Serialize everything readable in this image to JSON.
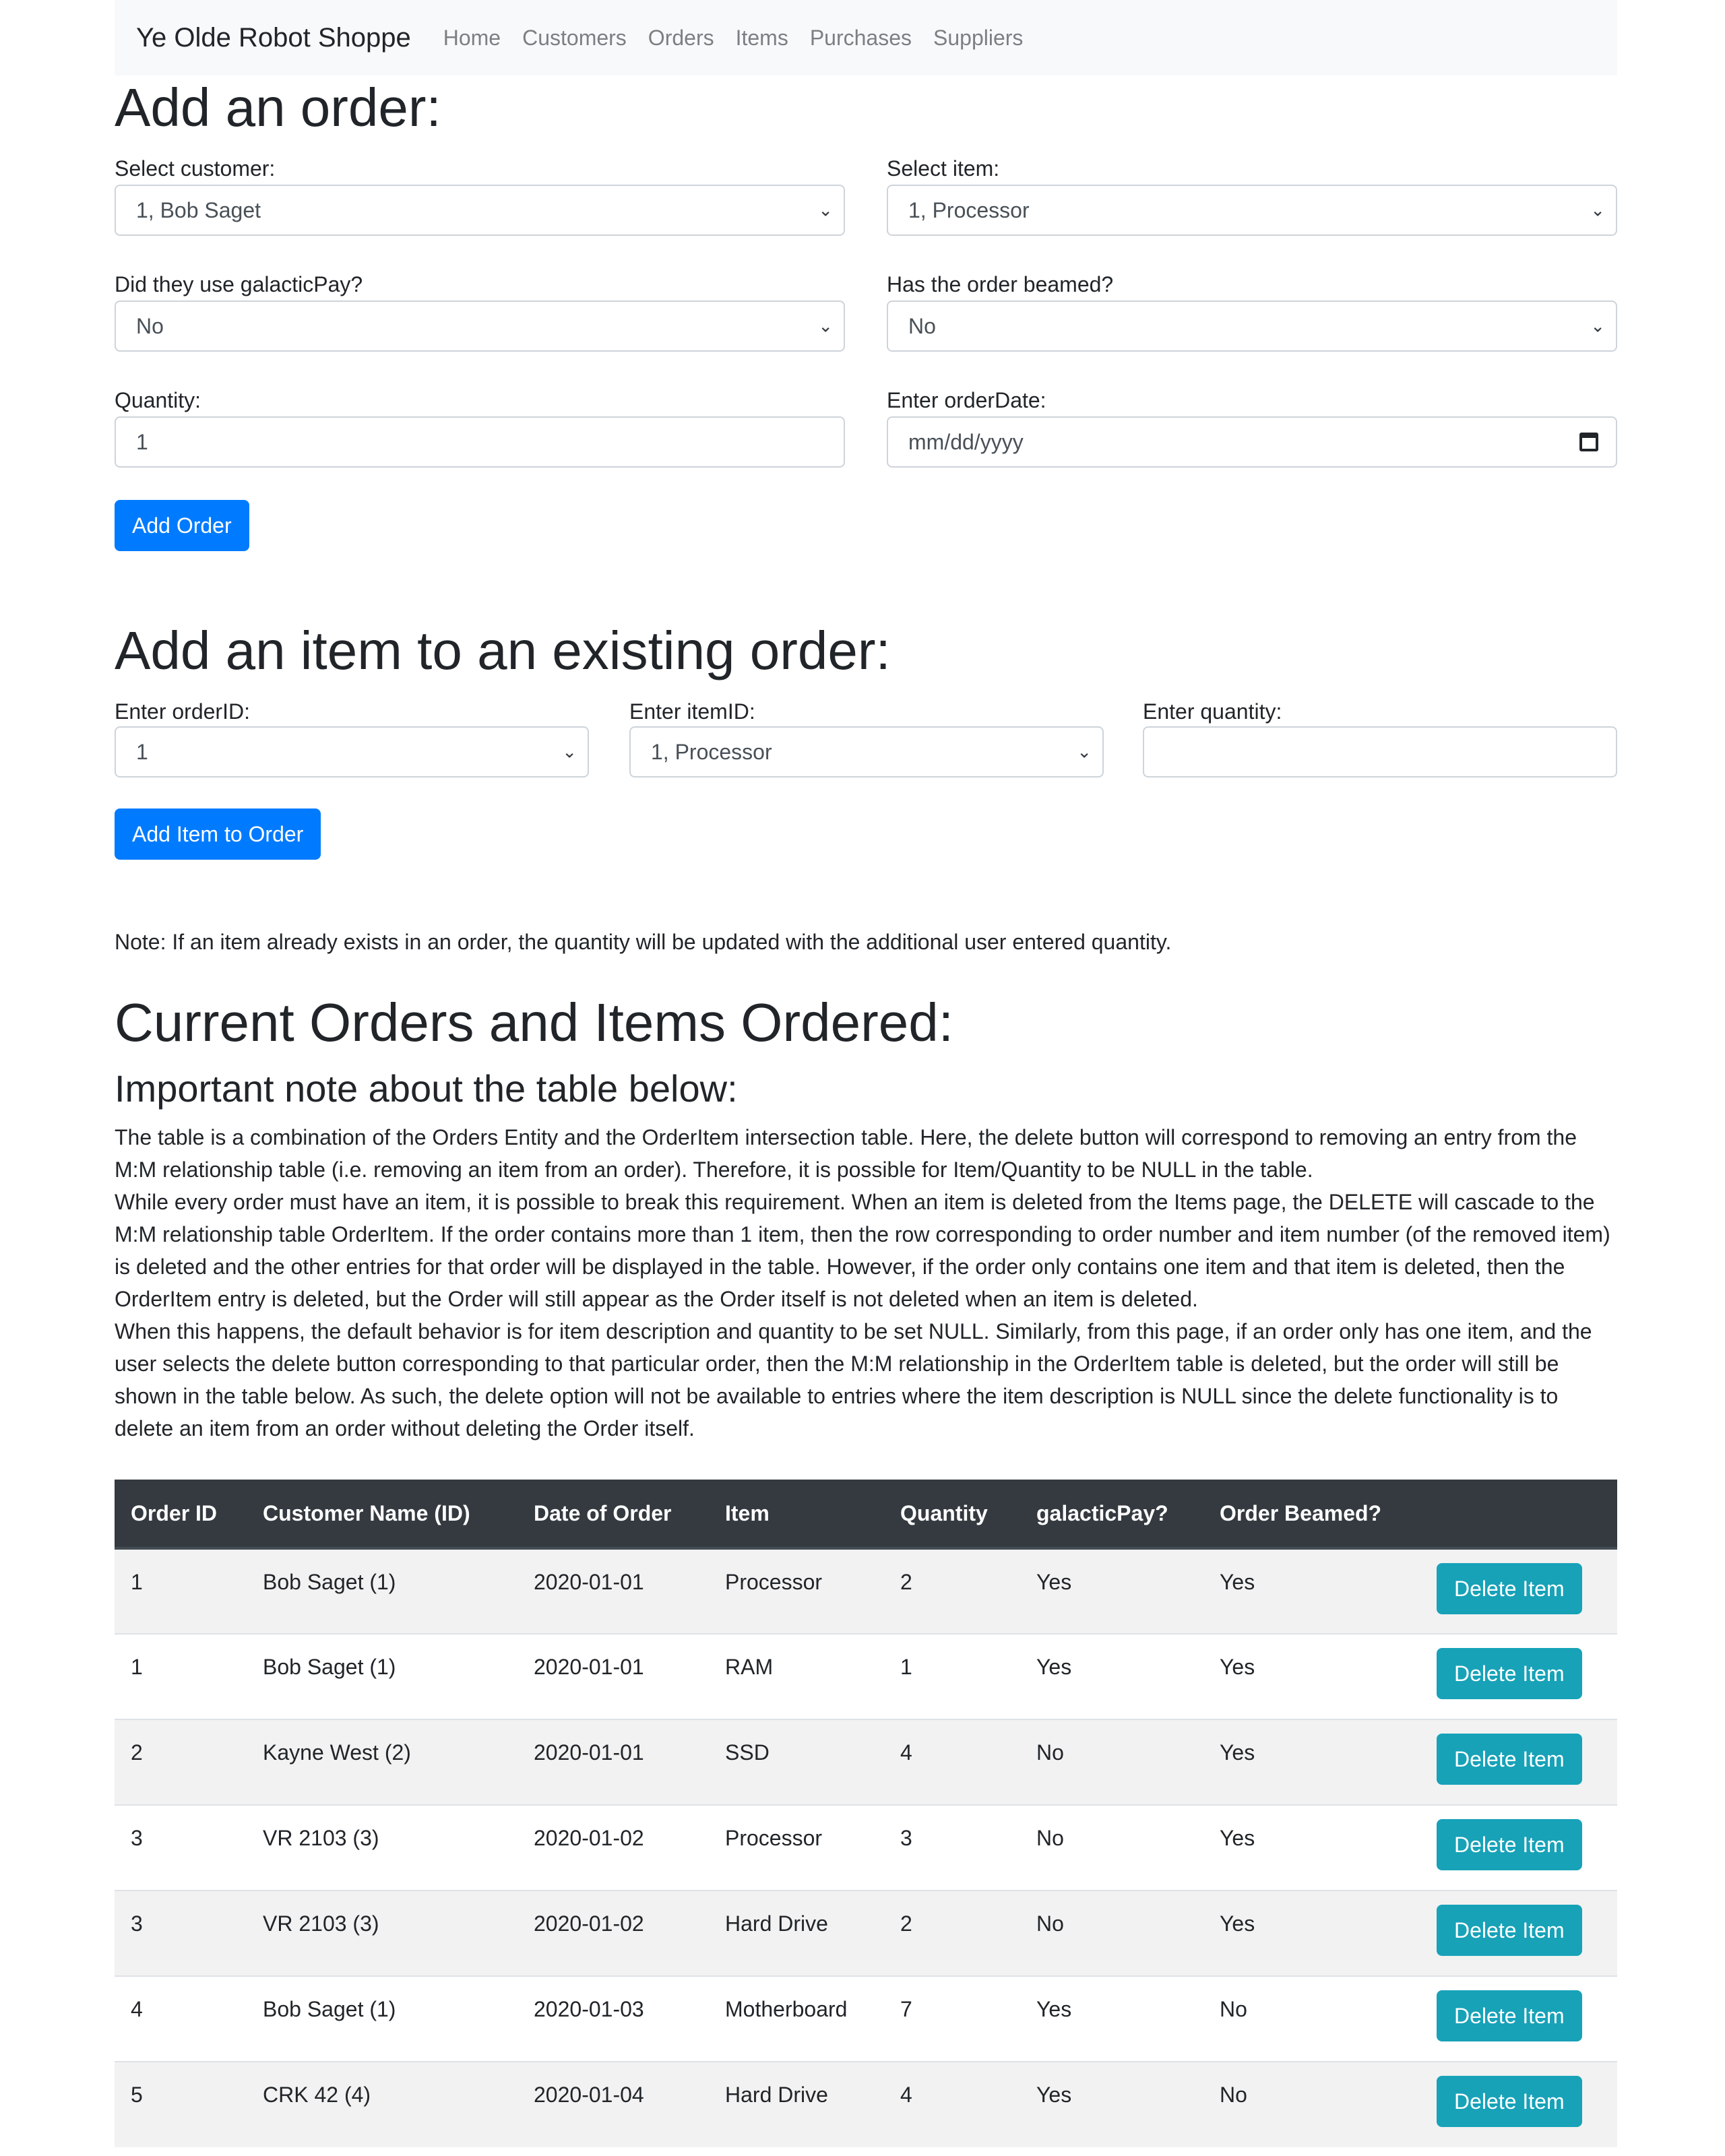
{
  "navbar": {
    "brand": "Ye Olde Robot Shoppe",
    "links": [
      "Home",
      "Customers",
      "Orders",
      "Items",
      "Purchases",
      "Suppliers"
    ]
  },
  "add_order": {
    "heading": "Add an order:",
    "customer_label": "Select customer:",
    "customer_value": "1, Bob Saget",
    "item_label": "Select item:",
    "item_value": "1, Processor",
    "galactic_label": "Did they use galacticPay?",
    "galactic_value": "No",
    "beamed_label": "Has the order beamed?",
    "beamed_value": "No",
    "quantity_label": "Quantity:",
    "quantity_value": "1",
    "date_label": "Enter orderDate:",
    "date_placeholder": "mm/dd/yyyy",
    "submit_label": "Add Order"
  },
  "add_item": {
    "heading": "Add an item to an existing order:",
    "order_label": "Enter orderID:",
    "order_value": "1",
    "item_label": "Enter itemID:",
    "item_value": "1, Processor",
    "quantity_label": "Enter quantity:",
    "quantity_value": "",
    "submit_label": "Add Item to Order",
    "note": "Note: If an item already exists in an order, the quantity will be updated with the additional user entered quantity."
  },
  "current": {
    "heading": "Current Orders and Items Ordered:",
    "subheading": "Important note about the table below:",
    "paragraphs": [
      "The table is a combination of the Orders Entity and the OrderItem intersection table. Here, the delete button will correspond to removing an entry from the M:M relationship table (i.e. removing an item from an order). Therefore, it is possible for Item/Quantity to be NULL in the table.",
      "While every order must have an item, it is possible to break this requirement. When an item is deleted from the Items page, the DELETE will cascade to the M:M relationship table OrderItem. If the order contains more than 1 item, then the row corresponding to order number and item number (of the removed item) is deleted and the other entries for that order will be displayed in the table. However, if the order only contains one item and that item is deleted, then the OrderItem entry is deleted, but the Order will still appear as the Order itself is not deleted when an item is deleted.",
      "When this happens, the default behavior is for item description and quantity to be set NULL. Similarly, from this page, if an order only has one item, and the user selects the delete button corresponding to that particular order, then the M:M relationship in the OrderItem table is deleted, but the order will still be shown in the table below. As such, the delete option will not be available to entries where the item description is NULL since the delete functionality is to delete an item from an order without deleting the Order itself."
    ]
  },
  "table": {
    "headers": [
      "Order ID",
      "Customer Name (ID)",
      "Date of Order",
      "Item",
      "Quantity",
      "galacticPay?",
      "Order Beamed?",
      ""
    ],
    "delete_label": "Delete Item",
    "rows": [
      [
        "1",
        "Bob Saget (1)",
        "2020-01-01",
        "Processor",
        "2",
        "Yes",
        "Yes"
      ],
      [
        "1",
        "Bob Saget (1)",
        "2020-01-01",
        "RAM",
        "1",
        "Yes",
        "Yes"
      ],
      [
        "2",
        "Kayne West (2)",
        "2020-01-01",
        "SSD",
        "4",
        "No",
        "Yes"
      ],
      [
        "3",
        "VR 2103 (3)",
        "2020-01-02",
        "Processor",
        "3",
        "No",
        "Yes"
      ],
      [
        "3",
        "VR 2103 (3)",
        "2020-01-02",
        "Hard Drive",
        "2",
        "No",
        "Yes"
      ],
      [
        "4",
        "Bob Saget (1)",
        "2020-01-03",
        "Motherboard",
        "7",
        "Yes",
        "No"
      ],
      [
        "5",
        "CRK 42 (4)",
        "2020-01-04",
        "Hard Drive",
        "4",
        "Yes",
        "No"
      ]
    ]
  },
  "icons": {
    "select_chevron": "chevron-down-icon",
    "date_picker": "calendar-icon"
  },
  "colors": {
    "primary": "#007bff",
    "info": "#17a2b8",
    "table_header": "#343a40",
    "navbar_bg": "#f8f9fa"
  }
}
